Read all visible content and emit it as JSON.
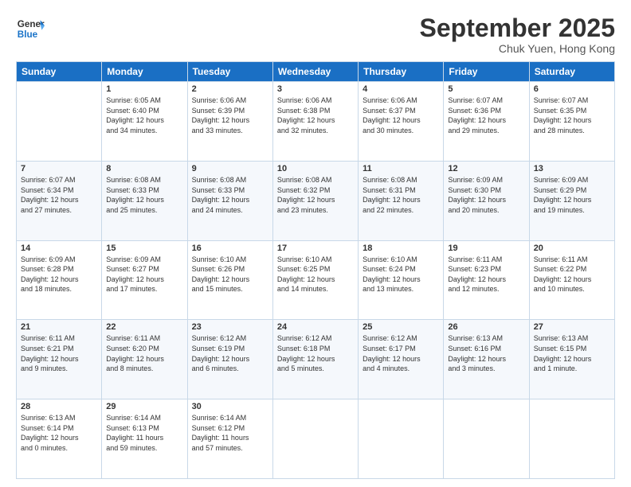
{
  "logo": {
    "line1": "General",
    "line2": "Blue"
  },
  "title": "September 2025",
  "subtitle": "Chuk Yuen, Hong Kong",
  "days_of_week": [
    "Sunday",
    "Monday",
    "Tuesday",
    "Wednesday",
    "Thursday",
    "Friday",
    "Saturday"
  ],
  "weeks": [
    [
      {
        "day": null,
        "info": null
      },
      {
        "day": "1",
        "info": "Sunrise: 6:05 AM\nSunset: 6:40 PM\nDaylight: 12 hours\nand 34 minutes."
      },
      {
        "day": "2",
        "info": "Sunrise: 6:06 AM\nSunset: 6:39 PM\nDaylight: 12 hours\nand 33 minutes."
      },
      {
        "day": "3",
        "info": "Sunrise: 6:06 AM\nSunset: 6:38 PM\nDaylight: 12 hours\nand 32 minutes."
      },
      {
        "day": "4",
        "info": "Sunrise: 6:06 AM\nSunset: 6:37 PM\nDaylight: 12 hours\nand 30 minutes."
      },
      {
        "day": "5",
        "info": "Sunrise: 6:07 AM\nSunset: 6:36 PM\nDaylight: 12 hours\nand 29 minutes."
      },
      {
        "day": "6",
        "info": "Sunrise: 6:07 AM\nSunset: 6:35 PM\nDaylight: 12 hours\nand 28 minutes."
      }
    ],
    [
      {
        "day": "7",
        "info": "Sunrise: 6:07 AM\nSunset: 6:34 PM\nDaylight: 12 hours\nand 27 minutes."
      },
      {
        "day": "8",
        "info": "Sunrise: 6:08 AM\nSunset: 6:33 PM\nDaylight: 12 hours\nand 25 minutes."
      },
      {
        "day": "9",
        "info": "Sunrise: 6:08 AM\nSunset: 6:33 PM\nDaylight: 12 hours\nand 24 minutes."
      },
      {
        "day": "10",
        "info": "Sunrise: 6:08 AM\nSunset: 6:32 PM\nDaylight: 12 hours\nand 23 minutes."
      },
      {
        "day": "11",
        "info": "Sunrise: 6:08 AM\nSunset: 6:31 PM\nDaylight: 12 hours\nand 22 minutes."
      },
      {
        "day": "12",
        "info": "Sunrise: 6:09 AM\nSunset: 6:30 PM\nDaylight: 12 hours\nand 20 minutes."
      },
      {
        "day": "13",
        "info": "Sunrise: 6:09 AM\nSunset: 6:29 PM\nDaylight: 12 hours\nand 19 minutes."
      }
    ],
    [
      {
        "day": "14",
        "info": "Sunrise: 6:09 AM\nSunset: 6:28 PM\nDaylight: 12 hours\nand 18 minutes."
      },
      {
        "day": "15",
        "info": "Sunrise: 6:09 AM\nSunset: 6:27 PM\nDaylight: 12 hours\nand 17 minutes."
      },
      {
        "day": "16",
        "info": "Sunrise: 6:10 AM\nSunset: 6:26 PM\nDaylight: 12 hours\nand 15 minutes."
      },
      {
        "day": "17",
        "info": "Sunrise: 6:10 AM\nSunset: 6:25 PM\nDaylight: 12 hours\nand 14 minutes."
      },
      {
        "day": "18",
        "info": "Sunrise: 6:10 AM\nSunset: 6:24 PM\nDaylight: 12 hours\nand 13 minutes."
      },
      {
        "day": "19",
        "info": "Sunrise: 6:11 AM\nSunset: 6:23 PM\nDaylight: 12 hours\nand 12 minutes."
      },
      {
        "day": "20",
        "info": "Sunrise: 6:11 AM\nSunset: 6:22 PM\nDaylight: 12 hours\nand 10 minutes."
      }
    ],
    [
      {
        "day": "21",
        "info": "Sunrise: 6:11 AM\nSunset: 6:21 PM\nDaylight: 12 hours\nand 9 minutes."
      },
      {
        "day": "22",
        "info": "Sunrise: 6:11 AM\nSunset: 6:20 PM\nDaylight: 12 hours\nand 8 minutes."
      },
      {
        "day": "23",
        "info": "Sunrise: 6:12 AM\nSunset: 6:19 PM\nDaylight: 12 hours\nand 6 minutes."
      },
      {
        "day": "24",
        "info": "Sunrise: 6:12 AM\nSunset: 6:18 PM\nDaylight: 12 hours\nand 5 minutes."
      },
      {
        "day": "25",
        "info": "Sunrise: 6:12 AM\nSunset: 6:17 PM\nDaylight: 12 hours\nand 4 minutes."
      },
      {
        "day": "26",
        "info": "Sunrise: 6:13 AM\nSunset: 6:16 PM\nDaylight: 12 hours\nand 3 minutes."
      },
      {
        "day": "27",
        "info": "Sunrise: 6:13 AM\nSunset: 6:15 PM\nDaylight: 12 hours\nand 1 minute."
      }
    ],
    [
      {
        "day": "28",
        "info": "Sunrise: 6:13 AM\nSunset: 6:14 PM\nDaylight: 12 hours\nand 0 minutes."
      },
      {
        "day": "29",
        "info": "Sunrise: 6:14 AM\nSunset: 6:13 PM\nDaylight: 11 hours\nand 59 minutes."
      },
      {
        "day": "30",
        "info": "Sunrise: 6:14 AM\nSunset: 6:12 PM\nDaylight: 11 hours\nand 57 minutes."
      },
      {
        "day": null,
        "info": null
      },
      {
        "day": null,
        "info": null
      },
      {
        "day": null,
        "info": null
      },
      {
        "day": null,
        "info": null
      }
    ]
  ]
}
